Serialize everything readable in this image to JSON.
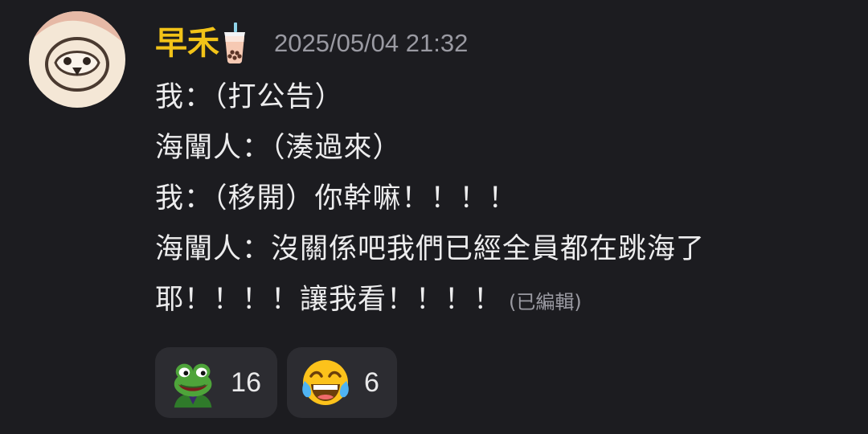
{
  "message": {
    "username": "早禾",
    "username_icon": "bubble-tea-icon",
    "avatar_icon": "penguin-avatar-icon",
    "timestamp": "2025/05/04 21:32",
    "lines": [
      "我：（打公告）",
      "海闡人：（湊過來）",
      "我：（移開）你幹嘛！！！！",
      "海闡人：沒關係吧我們已經全員都在跳海了",
      "耶！！！！讓我看！！！！"
    ],
    "edited_label": "(已編輯)"
  },
  "reactions": [
    {
      "icon": "frog-emoji-icon",
      "count": "16"
    },
    {
      "icon": "face-with-tears-of-joy-icon",
      "count": "6"
    }
  ],
  "colors": {
    "background": "#1c1c20",
    "username": "#f2c318",
    "muted_text": "#9a9aa2",
    "reaction_bg": "#2c2c31"
  }
}
